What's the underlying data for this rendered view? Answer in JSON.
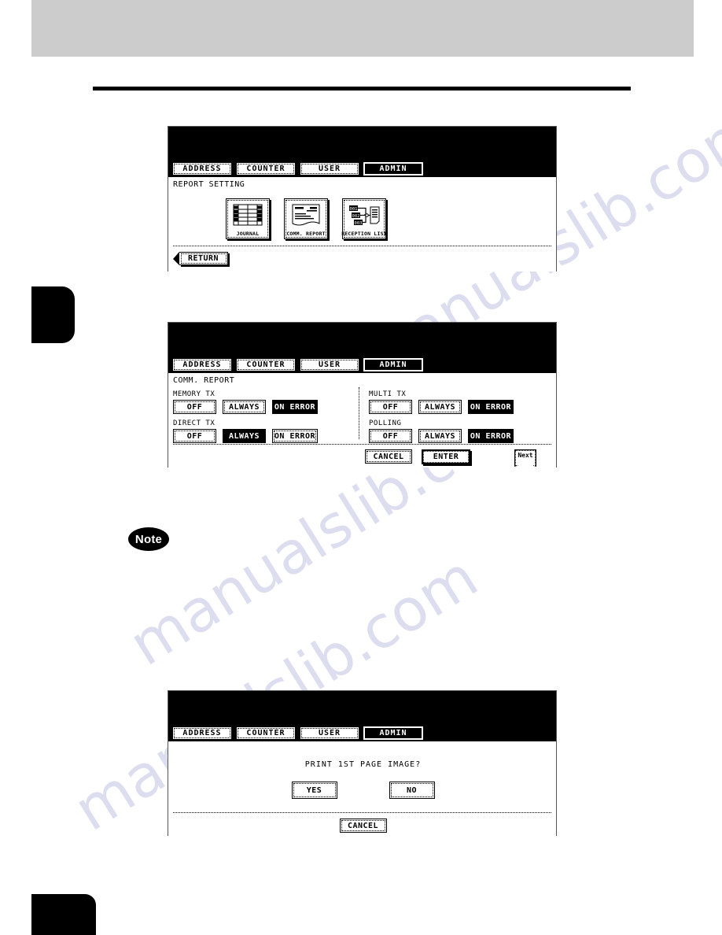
{
  "page": {
    "note_badge": "Note"
  },
  "watermark": {
    "line1": "manualslib.com",
    "line2": "manualslib.com",
    "line3": "manualslib.com"
  },
  "tabs": [
    "ADDRESS",
    "COUNTER",
    "USER",
    "ADMIN"
  ],
  "selected_tab": "ADMIN",
  "panel1": {
    "title": "REPORT SETTING",
    "icons": [
      {
        "label": "JOURNAL",
        "icon": "journal-table-icon"
      },
      {
        "label": "COMM. REPORT",
        "icon": "document-report-icon"
      },
      {
        "label": "RECEPTION LIST",
        "icon": "reception-flow-icon"
      }
    ],
    "return_label": "RETURN"
  },
  "panel2": {
    "title": "COMM. REPORT",
    "groups": [
      {
        "label": "MEMORY TX",
        "options": [
          "OFF",
          "ALWAYS",
          "ON ERROR"
        ],
        "selected": "ON ERROR"
      },
      {
        "label": "DIRECT TX",
        "options": [
          "OFF",
          "ALWAYS",
          "ON ERROR"
        ],
        "selected": "ALWAYS"
      },
      {
        "label": "MULTI TX",
        "options": [
          "OFF",
          "ALWAYS",
          "ON ERROR"
        ],
        "selected": "ON ERROR"
      },
      {
        "label": "POLLING",
        "options": [
          "OFF",
          "ALWAYS",
          "ON ERROR"
        ],
        "selected": "ON ERROR"
      }
    ],
    "cancel_label": "CANCEL",
    "enter_label": "ENTER",
    "next_label": "Next"
  },
  "panel3": {
    "message": "PRINT 1ST PAGE IMAGE?",
    "yes_label": "YES",
    "no_label": "NO",
    "cancel_label": "CANCEL"
  },
  "colors": {
    "lcd_background": "#ffffff",
    "lcd_foreground": "#000000",
    "header_band": "#cccccc",
    "watermark": "#d8d8ee"
  }
}
